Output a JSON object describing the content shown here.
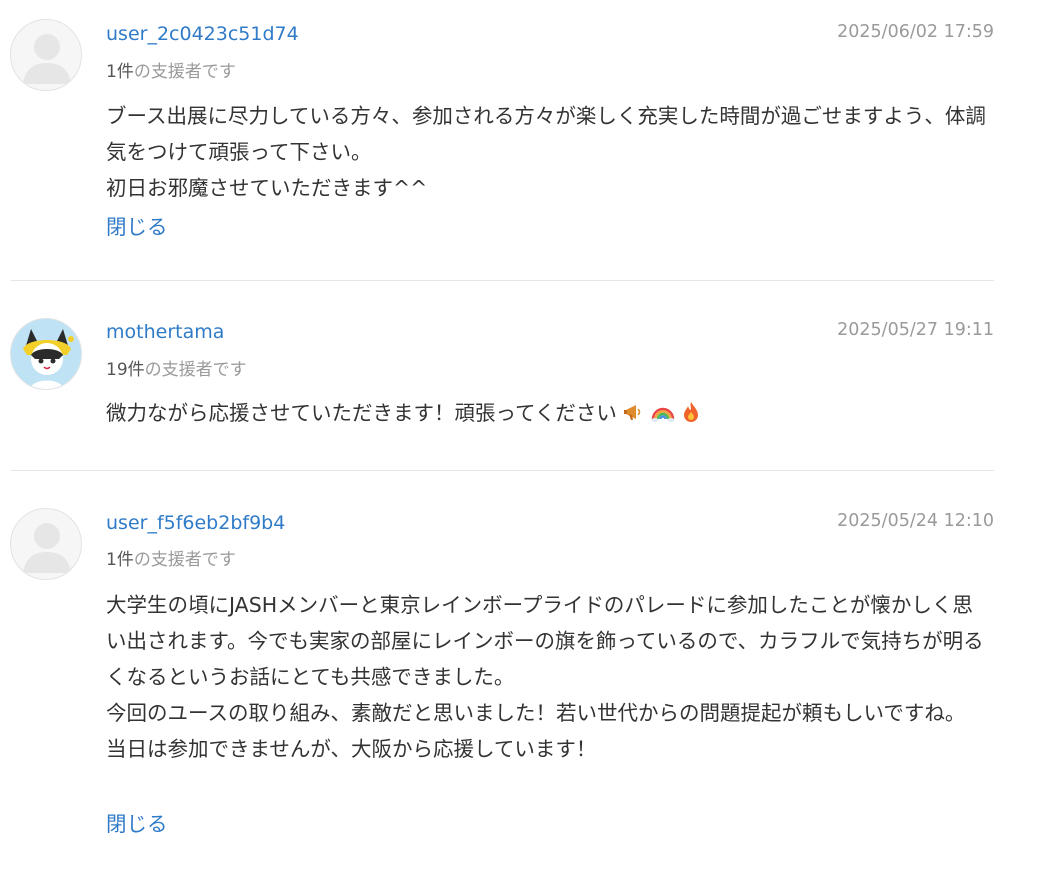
{
  "comments": [
    {
      "username": "user_2c0423c51d74",
      "date": "2025/06/02 17:59",
      "supporter_count": "1件",
      "supporter_suffix": "の支援者です",
      "body": [
        "ブース出展に尽力している方々、参加される方々が楽しく充実した時間が過ごせますよう、体調気をつけて頑張って下さい。",
        "初日お邪魔させていただきます^^"
      ],
      "close_label": "閉じる",
      "avatar": "default-user-icon"
    },
    {
      "username": "mothertama",
      "date": "2025/05/27 19:11",
      "supporter_count": "19件",
      "supporter_suffix": "の支援者です",
      "body": [
        "微力ながら応援させていただきます！頑張ってください"
      ],
      "emojis": [
        "megaphone-icon",
        "rainbow-icon",
        "fire-icon"
      ],
      "avatar": "character-avatar"
    },
    {
      "username": "user_f5f6eb2bf9b4",
      "date": "2025/05/24 12:10",
      "supporter_count": "1件",
      "supporter_suffix": "の支援者です",
      "body": [
        "大学生の頃にJASHメンバーと東京レインボープライドのパレードに参加したことが懐かしく思い出されます。今でも実家の部屋にレインボーの旗を飾っているので、カラフルで気持ちが明るくなるというお話にとても共感できました。",
        "今回のユースの取り組み、素敵だと思いました！若い世代からの問題提起が頼もしいですね。",
        "当日は参加できませんが、大阪から応援しています！"
      ],
      "close_label": "閉じる",
      "avatar": "default-user-icon"
    }
  ],
  "colors": {
    "link": "#2f7bc8",
    "muted": "#9a9a9a",
    "text": "#333333",
    "divider": "#e6e6e6"
  }
}
